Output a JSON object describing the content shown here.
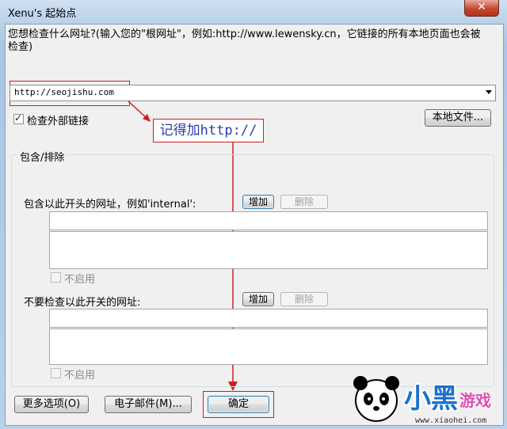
{
  "window": {
    "title": "Xenu's 起始点",
    "close_glyph": "✕"
  },
  "prompt": "您想检查什么网址?(输入您的\"根网址\"，例如:http://www.lewensky.cn，它链接的所有本地页面也会被检查)",
  "url_input": {
    "value": "http://seojishu.com"
  },
  "check_external": {
    "label": "检查外部链接",
    "checked": true
  },
  "local_file_button": "本地文件...",
  "annotation": "记得加http://",
  "include_exclude": {
    "group_title": "包含/排除",
    "include": {
      "label": "包含以此开头的网址，例如'internal':",
      "add": "增加",
      "remove": "删除",
      "disable_label": "不启用",
      "disabled": false
    },
    "exclude": {
      "label": "不要检查以此开关的网址:",
      "add": "增加",
      "remove": "删除",
      "disable_label": "不启用",
      "disabled": false
    }
  },
  "buttons": {
    "more_options": "更多选项(O)",
    "email": "电子邮件(M)...",
    "ok": "确定"
  },
  "watermark": {
    "brand": "小黑",
    "brand_suffix": "游戏",
    "site": "www.xiaohei.com"
  },
  "colors": {
    "annotation_red": "#d11d1d",
    "annotation_text": "#2b3ea8"
  }
}
